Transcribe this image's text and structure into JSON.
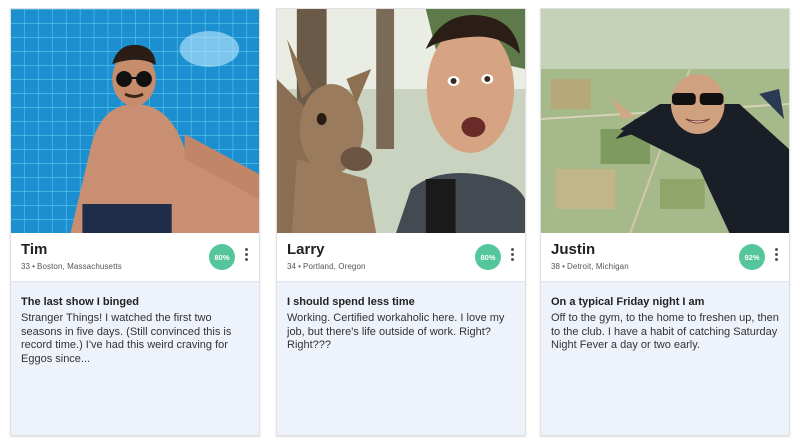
{
  "profiles": [
    {
      "name": "Tim",
      "age": "33",
      "location": "Boston, Massachusetts",
      "match": "80%",
      "prompt": "The last show I binged",
      "answer": "Stranger Things! I watched the first two seasons in five days. (Still convinced this is record time.) I've had this weird craving for Eggos since..."
    },
    {
      "name": "Larry",
      "age": "34",
      "location": "Portland, Oregon",
      "match": "80%",
      "prompt": "I should spend less time",
      "answer": "Working. Certified workaholic here. I love my job, but there's life outside of work. Right? Right???"
    },
    {
      "name": "Justin",
      "age": "38",
      "location": "Detroit, Michigan",
      "match": "92%",
      "prompt": "On a typical Friday night I am",
      "answer": "Off to the gym, to the home to freshen up, then to the club. I have a habit of catching Saturday Night Fever a day or two early."
    }
  ],
  "separator": "•",
  "colors": {
    "match_badge": "#55c59b",
    "answer_bg": "#eef2fa"
  }
}
